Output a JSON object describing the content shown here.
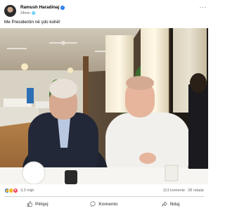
{
  "post": {
    "author_name": "Ramush Haradinaj",
    "verified_icon": "verified-badge-icon",
    "timestamp": "24min",
    "privacy_icon": "globe-icon",
    "more_label": "···",
    "caption": "Me Presidentin në çdo kohë!"
  },
  "stats": {
    "reaction_icons": [
      "like-icon",
      "haha-icon",
      "love-icon"
    ],
    "reactions_count": "3,2 mijë",
    "comments_count": "113 komente",
    "shares_count": "28 ndarje"
  },
  "actions": {
    "like_label": "Pëlqej",
    "comment_label": "Komento",
    "share_label": "Ndaj"
  },
  "colors": {
    "accent": "#1877f2",
    "secondary_text": "#65676b",
    "divider": "#ced0d4"
  }
}
